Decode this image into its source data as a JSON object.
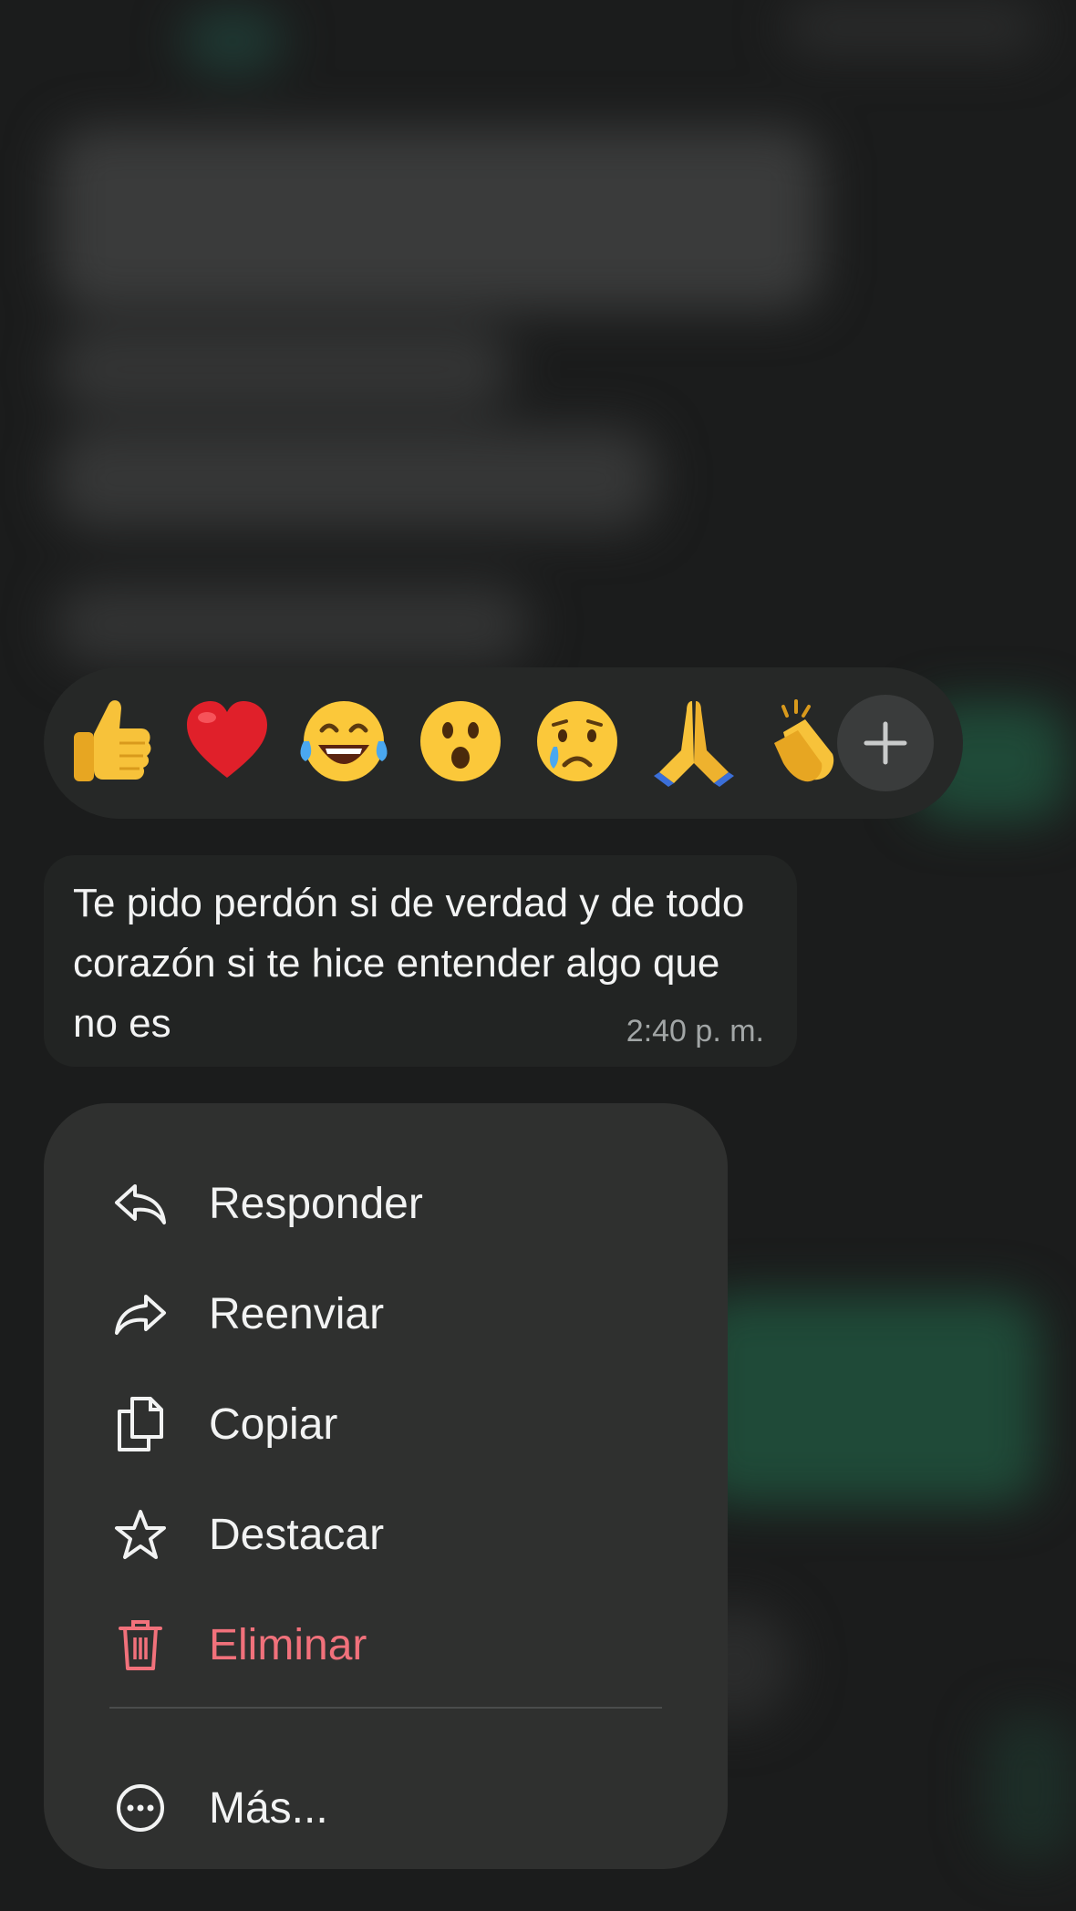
{
  "reactions": {
    "emojis": [
      "👍",
      "❤️",
      "😂",
      "😮",
      "😢",
      "🙏",
      "👏"
    ],
    "add_icon": "plus-icon"
  },
  "message": {
    "text": "Te pido perdón si de verdad y de todo corazón si te hice entender algo que no es",
    "time": "2:40 p. m."
  },
  "menu": {
    "items": [
      {
        "label": "Responder",
        "icon": "reply-icon"
      },
      {
        "label": "Reenviar",
        "icon": "forward-icon"
      },
      {
        "label": "Copiar",
        "icon": "copy-icon"
      },
      {
        "label": "Destacar",
        "icon": "star-icon"
      },
      {
        "label": "Eliminar",
        "icon": "trash-icon"
      }
    ],
    "more": {
      "label": "Más...",
      "icon": "more-dots-icon"
    }
  },
  "colors": {
    "danger": "#f1717b",
    "menu_bg": "#2f302f",
    "bubble_bg": "#222423",
    "background": "#1b1c1c"
  }
}
